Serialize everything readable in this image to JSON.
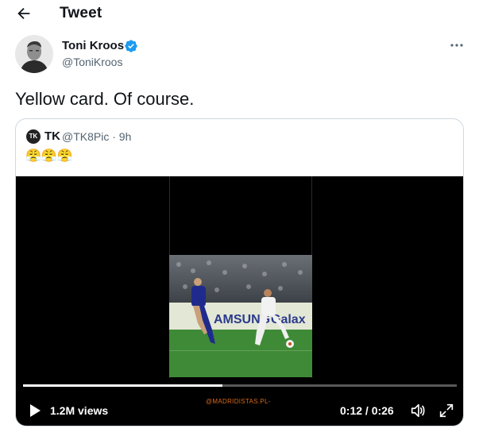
{
  "header": {
    "title": "Tweet",
    "back_icon": "arrow-left-icon"
  },
  "tweet": {
    "author_name": "Toni Kroos",
    "verified_icon": "verified-badge-icon",
    "verified_color": "#1d9bf0",
    "handle": "@ToniKroos",
    "text": "Yellow card. Of course.",
    "more_icon": "ellipsis-icon"
  },
  "quote": {
    "avatar_text": "TK",
    "author_name": "TK",
    "handle_time": "@TK8Pic · 9h",
    "emojis": "😤😤😤",
    "video": {
      "views": "1.2M views",
      "time": "0:12 / 0:26",
      "watermark": "@MADRIDISTAS.PL-",
      "progress": 0.46,
      "play_icon": "play-icon",
      "volume_icon": "volume-icon",
      "fullscreen_icon": "expand-icon"
    }
  },
  "colors": {
    "text": "#0f1419",
    "muted": "#536471",
    "border": "#cfd9de",
    "video_bg": "#000000"
  }
}
